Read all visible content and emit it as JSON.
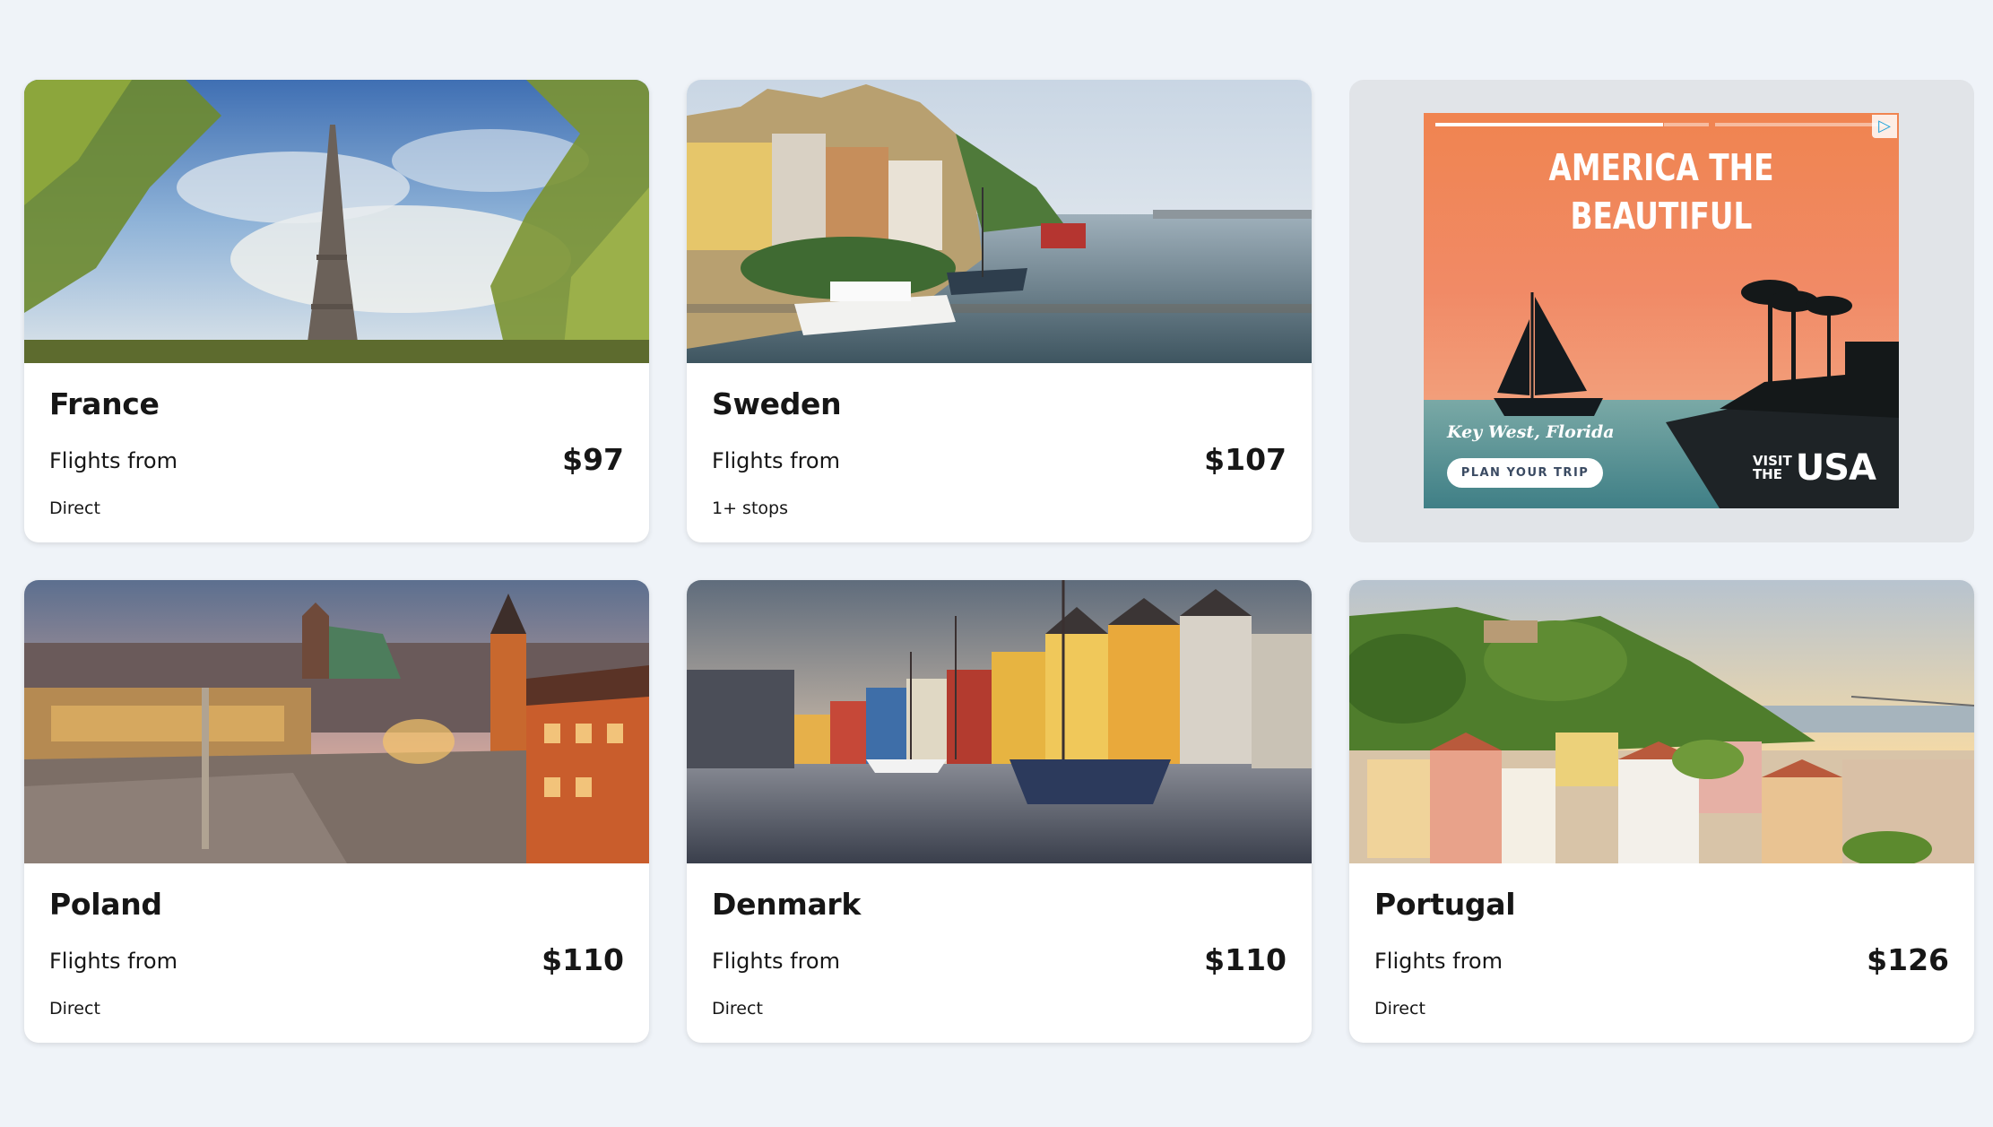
{
  "destinations": [
    {
      "name": "France",
      "flights_from": "Flights from",
      "price": "$97",
      "stops": "Direct",
      "image": "eiffel-tower-photo"
    },
    {
      "name": "Sweden",
      "flights_from": "Flights from",
      "price": "$107",
      "stops": "1+ stops",
      "image": "stockholm-waterfront-photo"
    },
    {
      "name": "Poland",
      "flights_from": "Flights from",
      "price": "$110",
      "stops": "Direct",
      "image": "warsaw-old-town-photo"
    },
    {
      "name": "Denmark",
      "flights_from": "Flights from",
      "price": "$110",
      "stops": "Direct",
      "image": "nyhavn-canal-photo"
    },
    {
      "name": "Portugal",
      "flights_from": "Flights from",
      "price": "$126",
      "stops": "Direct",
      "image": "lisbon-hillside-photo"
    }
  ],
  "ad": {
    "headline_line1": "AMERICA THE",
    "headline_line2": "BEAUTIFUL",
    "location": "Key West, Florida",
    "cta": "PLAN YOUR TRIP",
    "brand_small1": "VISIT",
    "brand_small2": "THE",
    "brand_big": "USA",
    "adchoices_icon": "adchoices-icon"
  },
  "colors": {
    "page_background": "#eff3f8",
    "card_background": "#ffffff",
    "ad_slot_background": "#e1e4e8",
    "text": "#161616"
  }
}
